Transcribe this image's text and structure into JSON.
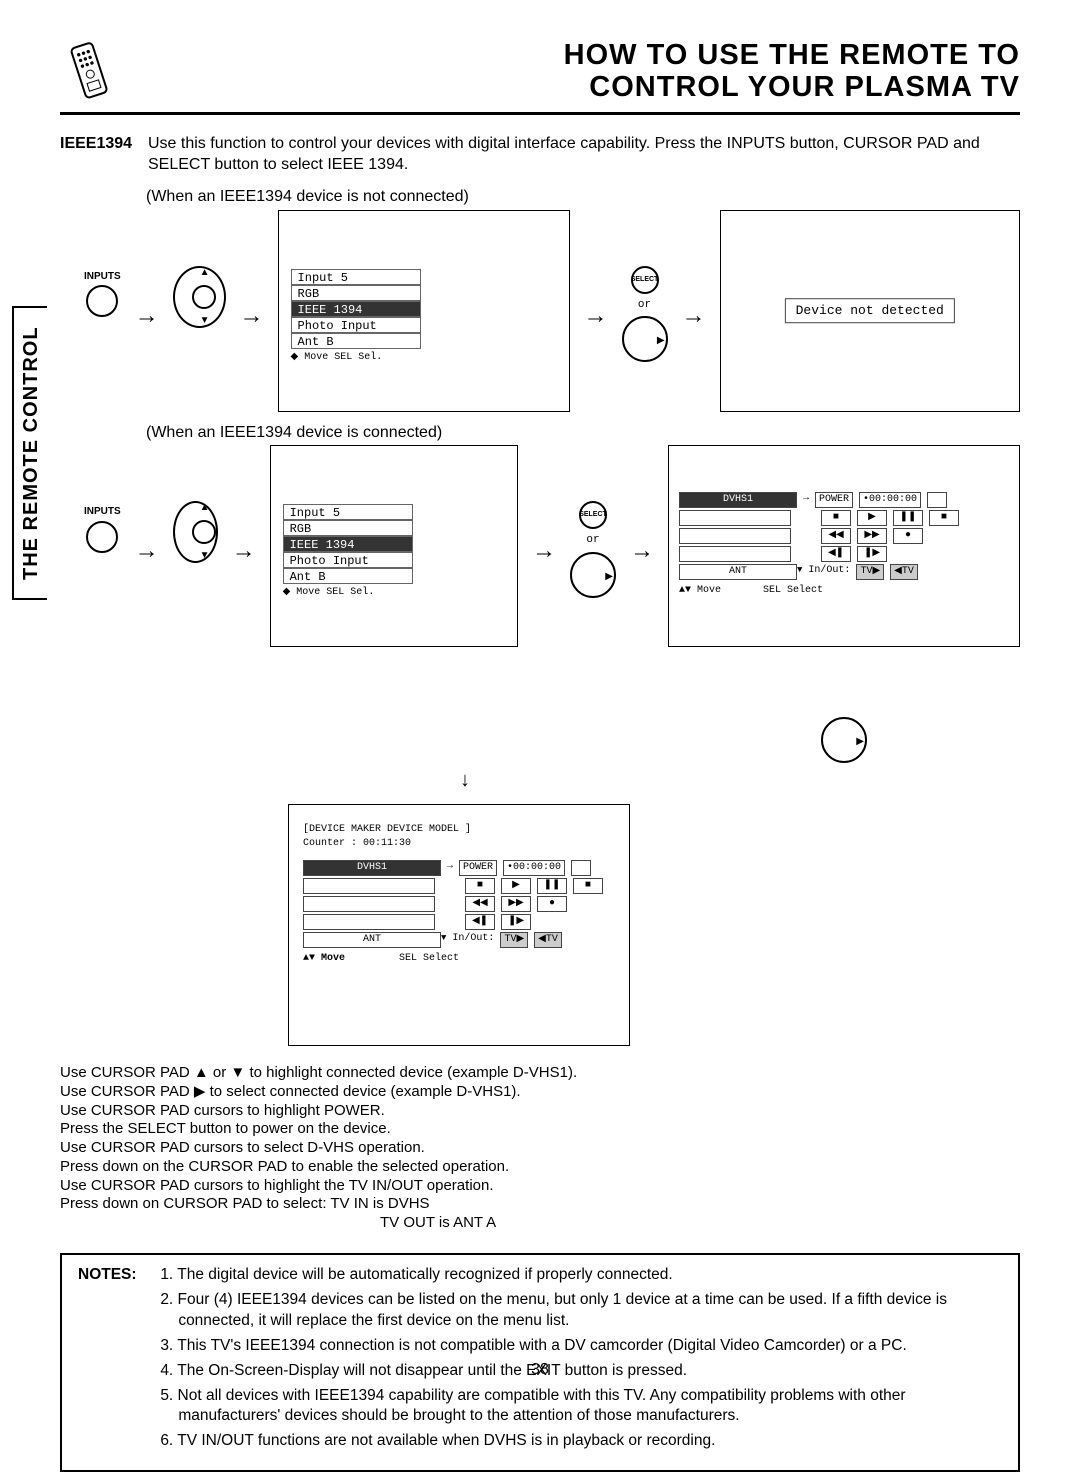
{
  "header": {
    "title_line1": "HOW TO  USE THE REMOTE TO",
    "title_line2": "CONTROL YOUR PLASMA TV"
  },
  "side_tab": "THE REMOTE CONTROL",
  "ieee": {
    "label": "IEEE1394",
    "desc": "Use this function to control your devices with digital interface capability.  Press the INPUTS button, CURSOR PAD and SELECT button to select IEEE 1394."
  },
  "when_not_connected": "(When an IEEE1394 device is not connected)",
  "when_connected": "(When an IEEE1394 device is connected)",
  "inputs_label": "INPUTS",
  "osd_menu": {
    "item1": "Input 5",
    "item2": "RGB",
    "item3": "IEEE 1394",
    "item4": "Photo Input",
    "item5": "Ant B",
    "footer": "◆ Move  SEL Sel."
  },
  "select_label": "SELECT",
  "or_label": "or",
  "device_not_detected": "Device not detected",
  "dvhs_panel": {
    "title": "DVHS1",
    "power": "POWER",
    "counter_zero": "•00:00:00",
    "ant": "ANT",
    "inout": "In/Out:",
    "tv_arrow_r": "TV▶",
    "tv_arrow_l": "◀TV",
    "foot_move": "▲▼ Move",
    "foot_select": "SEL Select"
  },
  "big_osd": {
    "head": "[DEVICE MAKER      DEVICE MODEL        ]",
    "counter": "Counter       :  00:11:30",
    "title": "DVHS1",
    "power": "POWER",
    "counter_zero": "•00:00:00",
    "ant": "ANT",
    "inout": "In/Out:",
    "foot_move": "▲▼ Move",
    "foot_select": "SEL Select"
  },
  "instructions": {
    "l1": "Use CURSOR PAD ▲ or ▼ to highlight connected device (example D-VHS1).",
    "l2": "Use CURSOR PAD ▶  to select connected device (example D-VHS1).",
    "l3": "Use CURSOR PAD cursors to highlight POWER.",
    "l4": "Press the SELECT button to power on the device.",
    "l5": "Use CURSOR PAD cursors to select D-VHS operation.",
    "l6": "Press down on the CURSOR PAD to enable the selected operation.",
    "l7": "Use CURSOR PAD cursors to highlight the TV IN/OUT operation.",
    "l8": "Press down on CURSOR PAD to select: TV IN is DVHS",
    "l9": "TV OUT is ANT A"
  },
  "notes": {
    "label": "NOTES:",
    "n1": "1. The digital device will be automatically recognized if properly connected.",
    "n2": "2. Four (4) IEEE1394 devices can be listed on the menu, but only 1 device at a time can be used.  If a fifth device is connected, it will replace the first device on the menu list.",
    "n3": "3. This TV's IEEE1394 connection is not compatible with a DV camcorder (Digital Video Camcorder) or a PC.",
    "n4": "4. The On-Screen-Display will not disappear until the EXIT button is pressed.",
    "n5": "5. Not all devices with IEEE1394 capability are compatible with this TV.  Any compatibility problems with other manufacturers' devices should be brought to the attention of those manufacturers.",
    "n6": "6. TV IN/OUT functions are not available when DVHS is in playback or recording."
  },
  "page_number": "38"
}
